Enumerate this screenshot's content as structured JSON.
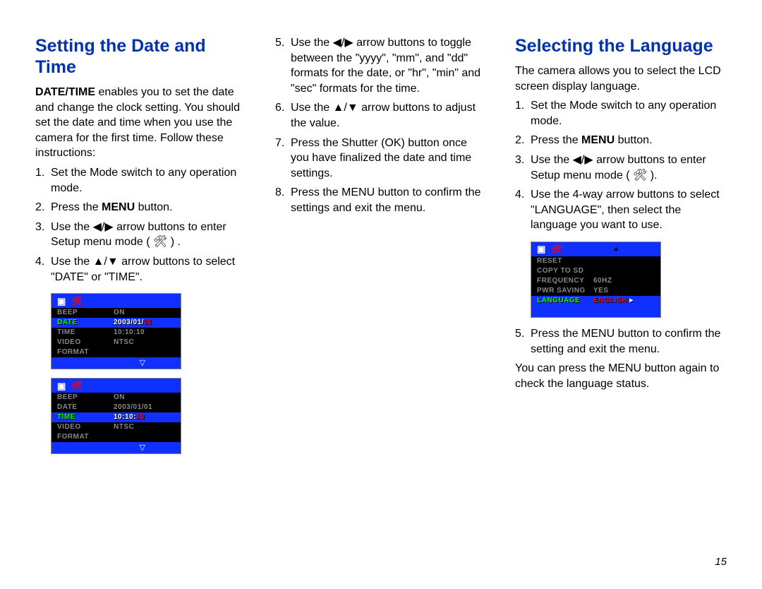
{
  "pageNumber": "15",
  "col1": {
    "heading": "Setting the Date and Time",
    "intro_strong": "DATE/TIME",
    "intro_rest": " enables you to set the date and change the clock setting. You should set the date and time when you use the camera for the first time. Follow these instructions:",
    "steps": [
      "Set the Mode switch to any operation mode.",
      {
        "pre": "Press the ",
        "strong": "MENU",
        "post": " button."
      },
      "Use the ◀/▶ arrow buttons to enter Setup menu mode ( 🛠 ) .",
      "Use the ▲/▼ arrow buttons to select \"DATE\" or \"TIME\"."
    ]
  },
  "lcd1": {
    "rows": [
      {
        "label": "BEEP",
        "val": "ON"
      },
      {
        "label": "DATE",
        "val_pre": "2003/01/",
        "val_hi": "01",
        "selected": true
      },
      {
        "label": "TIME",
        "val": "10:10:10"
      },
      {
        "label": "VIDEO",
        "val": "NTSC"
      },
      {
        "label": "FORMAT",
        "val": ""
      }
    ]
  },
  "lcd2": {
    "rows": [
      {
        "label": "BEEP",
        "val": "ON"
      },
      {
        "label": "DATE",
        "val": "2003/01/01"
      },
      {
        "label": "TIME",
        "val_pre": "10:10:",
        "val_hi": "10",
        "selected": true
      },
      {
        "label": "VIDEO",
        "val": "NTSC"
      },
      {
        "label": "FORMAT",
        "val": ""
      }
    ]
  },
  "col2": {
    "steps": [
      "Use the ◀/▶ arrow buttons to toggle between the \"yyyy\", \"mm\", and \"dd\" formats for the date, or \"hr\", \"min\" and \"sec\" formats for the time.",
      "Use the ▲/▼ arrow buttons to adjust the value.",
      "Press the Shutter (OK) button once you have finalized the date and time settings.",
      "Press the MENU button to confirm the settings and exit the menu."
    ]
  },
  "col3": {
    "heading": "Selecting the Language",
    "intro": "The camera allows you to select the LCD screen display language.",
    "steps": [
      "Set the Mode switch to any operation mode.",
      {
        "pre": "Press the ",
        "strong": "MENU",
        "post": " button."
      },
      "Use the ◀/▶ arrow buttons to enter Setup menu mode ( 🛠 ).",
      "Use the 4-way arrow buttons to select \"LANGUAGE\", then select the language you want to use."
    ],
    "steps2": [
      "Press the MENU button to confirm the setting and exit the menu."
    ],
    "tail": "You can press the MENU button again to check the language status."
  },
  "lcd3": {
    "rows": [
      {
        "label": "RESET",
        "val": ""
      },
      {
        "label": "COPY TO SD",
        "val": ""
      },
      {
        "label": "FREQUENCY",
        "val": "60HZ"
      },
      {
        "label": "PWR SAVING",
        "val": "YES"
      },
      {
        "label": "LANGUAGE",
        "val_red": "ENGLISH",
        "selected": true,
        "arrowRight": true
      }
    ]
  }
}
